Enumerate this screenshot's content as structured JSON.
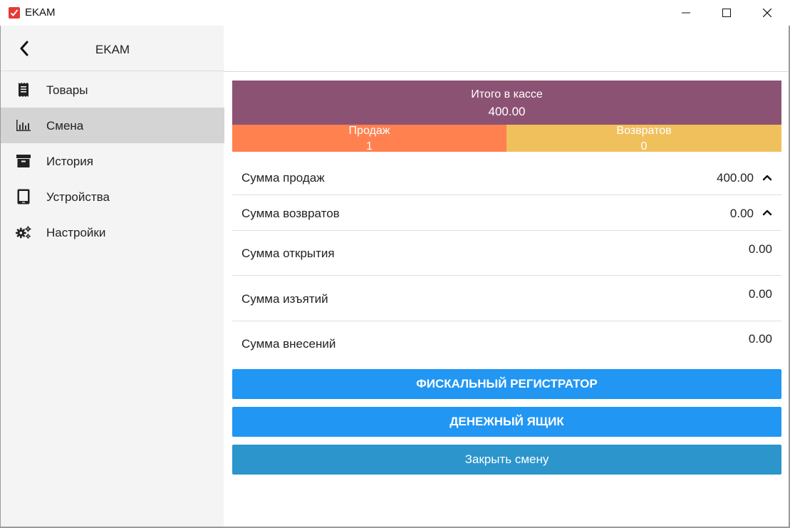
{
  "window": {
    "title": "EKAM"
  },
  "sidebar": {
    "title": "EKAM",
    "items": [
      {
        "label": "Товары",
        "icon": "receipt-icon"
      },
      {
        "label": "Смена",
        "icon": "bar-chart-icon"
      },
      {
        "label": "История",
        "icon": "archive-icon"
      },
      {
        "label": "Устройства",
        "icon": "tablet-icon"
      },
      {
        "label": "Настройки",
        "icon": "gears-icon"
      }
    ],
    "active_index": 1
  },
  "summary": {
    "total_label": "Итого в кассе",
    "total_value": "400.00",
    "sales_label": "Продаж",
    "sales_count": "1",
    "returns_label": "Возвратов",
    "returns_count": "0"
  },
  "rows": [
    {
      "label": "Сумма продаж",
      "value": "400.00",
      "expandable": true
    },
    {
      "label": "Сумма возвратов",
      "value": "0.00",
      "expandable": true
    },
    {
      "label": "Сумма открытия",
      "value": "0.00",
      "expandable": false
    },
    {
      "label": "Сумма изъятий",
      "value": "0.00",
      "expandable": false
    },
    {
      "label": "Сумма внесений",
      "value": "0.00",
      "expandable": false
    }
  ],
  "buttons": {
    "fiscal": "ФИСКАЛЬНЫЙ РЕГИСТРАТОР",
    "cash_drawer": "ДЕНЕЖНЫЙ ЯЩИК",
    "close_shift": "Закрыть смену"
  },
  "colors": {
    "banner": "#8c5273",
    "sales": "#ff8150",
    "returns": "#f0c05c",
    "primary_button": "#2196f3",
    "close_button": "#2b95cc",
    "logo": "#e53935"
  }
}
